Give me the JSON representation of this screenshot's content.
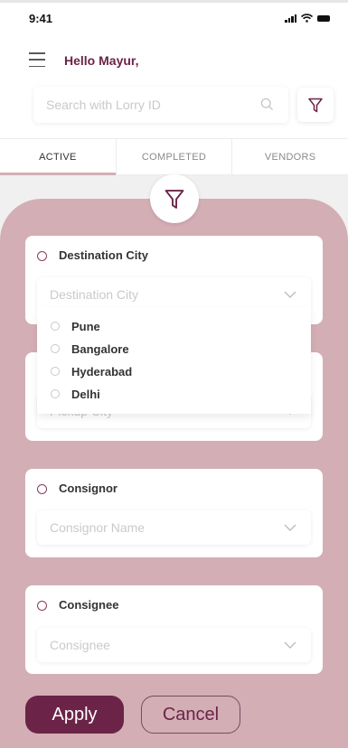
{
  "status_bar": {
    "time": "9:41"
  },
  "header": {
    "greeting": "Hello Mayur,"
  },
  "search": {
    "placeholder": "Search with Lorry ID",
    "value": ""
  },
  "tabs": [
    {
      "label": "ACTIVE",
      "active": true
    },
    {
      "label": "COMPLETED",
      "active": false
    },
    {
      "label": "VENDORS",
      "active": false
    }
  ],
  "filters": {
    "destination": {
      "title": "Destination City",
      "placeholder": "Destination City",
      "options": [
        "Pune",
        "Bangalore",
        "Hyderabad",
        "Delhi"
      ]
    },
    "pickup": {
      "placeholder": "Pickup City"
    },
    "consignor": {
      "title": "Consignor",
      "placeholder": "Consignor Name"
    },
    "consignee": {
      "title": "Consignee",
      "placeholder": "Consignee"
    }
  },
  "actions": {
    "apply_label": "Apply",
    "cancel_label": "Cancel"
  },
  "colors": {
    "brand": "#6b2448",
    "sheet": "#d4aeb5",
    "radio": "#8a3b5f"
  },
  "icons": [
    "signal-icon",
    "wifi-icon",
    "battery-icon",
    "menu-icon",
    "search-icon",
    "filter-icon",
    "chevron-down-icon"
  ]
}
